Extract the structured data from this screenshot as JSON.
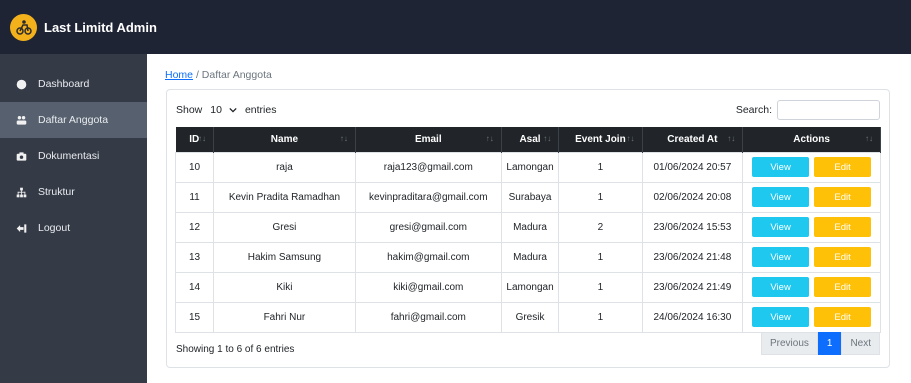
{
  "app": {
    "title": "Last Limitd Admin"
  },
  "sidebar": {
    "items": [
      {
        "label": "Dashboard",
        "icon": "dashboard-icon"
      },
      {
        "label": "Daftar Anggota",
        "icon": "users-icon",
        "active": true
      },
      {
        "label": "Dokumentasi",
        "icon": "camera-icon"
      },
      {
        "label": "Struktur",
        "icon": "sitemap-icon"
      },
      {
        "label": "Logout",
        "icon": "logout-icon"
      }
    ]
  },
  "breadcrumb": {
    "home": "Home",
    "separator": "/",
    "current": "Daftar Anggota"
  },
  "table_controls": {
    "show_label": "Show",
    "entries_value": "10",
    "entries_label": "entries",
    "search_label": "Search:",
    "search_value": ""
  },
  "table": {
    "columns": [
      "ID",
      "Name",
      "Email",
      "Asal",
      "Event Join",
      "Created At",
      "Actions"
    ],
    "rows": [
      {
        "id": "10",
        "name": "raja",
        "email": "raja123@gmail.com",
        "asal": "Lamongan",
        "event": "1",
        "created": "01/06/2024 20:57"
      },
      {
        "id": "11",
        "name": "Kevin Pradita Ramadhan",
        "email": "kevinpraditara@gmail.com",
        "asal": "Surabaya",
        "event": "1",
        "created": "02/06/2024 20:08"
      },
      {
        "id": "12",
        "name": "Gresi",
        "email": "gresi@gmail.com",
        "asal": "Madura",
        "event": "2",
        "created": "23/06/2024 15:53"
      },
      {
        "id": "13",
        "name": "Hakim Samsung",
        "email": "hakim@gmail.com",
        "asal": "Madura",
        "event": "1",
        "created": "23/06/2024 21:48"
      },
      {
        "id": "14",
        "name": "Kiki",
        "email": "kiki@gmail.com",
        "asal": "Lamongan",
        "event": "1",
        "created": "23/06/2024 21:49"
      },
      {
        "id": "15",
        "name": "Fahri Nur",
        "email": "fahri@gmail.com",
        "asal": "Gresik",
        "event": "1",
        "created": "24/06/2024 16:30"
      }
    ],
    "view_label": "View",
    "edit_label": "Edit"
  },
  "footer": {
    "info": "Showing 1 to 6 of 6 entries",
    "prev": "Previous",
    "page": "1",
    "next": "Next"
  },
  "colors": {
    "topbar": "#1e2434",
    "sidebar": "#343a46",
    "active_item": "#56606e",
    "view": "#1ec8ef",
    "edit": "#ffc107",
    "page_active": "#0d6efd"
  }
}
